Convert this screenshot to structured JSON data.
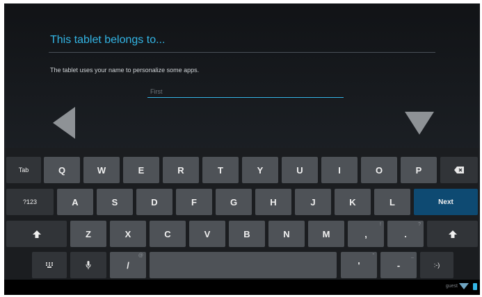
{
  "setup": {
    "title": "This tablet belongs to...",
    "description": "The tablet uses your name to personalize some apps.",
    "name_field": {
      "placeholder": "First",
      "value": ""
    }
  },
  "navigation": {
    "back_icon": "left-triangle-icon",
    "next_icon": "down-triangle-icon"
  },
  "keyboard": {
    "tab": "Tab",
    "row1": [
      "Q",
      "W",
      "E",
      "R",
      "T",
      "Y",
      "U",
      "I",
      "O",
      "P"
    ],
    "backspace_icon": "backspace-icon",
    "symbols": "?123",
    "row2": [
      "A",
      "S",
      "D",
      "F",
      "G",
      "H",
      "J",
      "K",
      "L"
    ],
    "next": "Next",
    "shift_icon": "shift-up-arrow-icon",
    "row3": [
      "Z",
      "X",
      "C",
      "V",
      "B",
      "N",
      "M"
    ],
    "row3_punct": [
      {
        "label": ",",
        "hint": "!"
      },
      {
        "label": ".",
        "hint": "?"
      }
    ],
    "settings_icon": "keyboard-settings-icon",
    "mic_icon": "microphone-icon",
    "slash": "/",
    "slash_hint": "@",
    "apostrophe": "'",
    "apostrophe_hint": "\"",
    "dash": "-",
    "dash_hint": "_",
    "smiley": ":-)"
  },
  "status_bar": {
    "user": "guest",
    "wifi_icon": "wifi-icon",
    "battery_icon": "battery-icon"
  }
}
